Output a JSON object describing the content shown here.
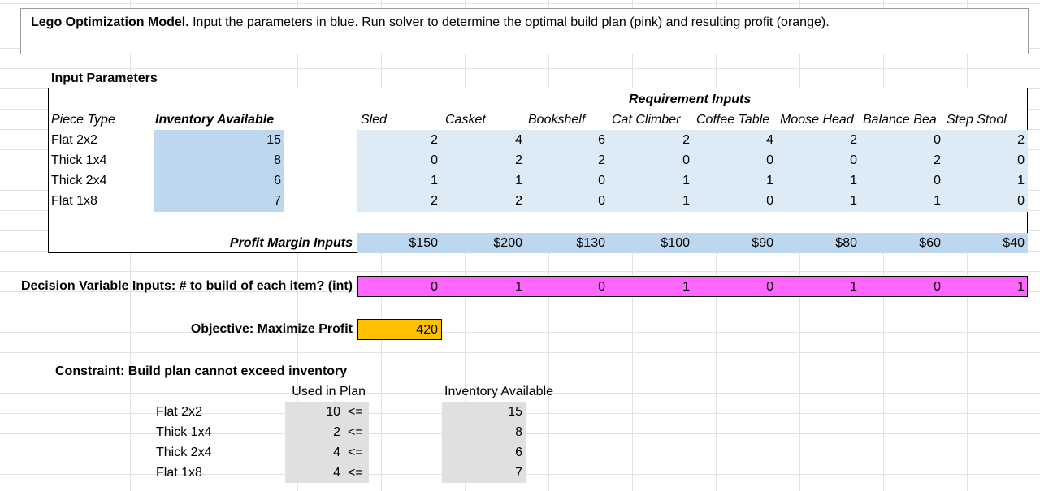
{
  "title": {
    "bold": "Lego Optimization Model.",
    "rest": " Input the parameters in blue. Run solver to determine the optimal build plan (pink) and resulting profit (orange)."
  },
  "input_params_label": "Input Parameters",
  "requirement_inputs_label": "Requirement Inputs",
  "headers": {
    "piece_type": "Piece Type",
    "inventory": "Inventory Available",
    "items": [
      "Sled",
      "Casket",
      "Bookshelf",
      "Cat Climber",
      "Coffee Table",
      "Moose Head",
      "Balance Beam",
      "Step Stool"
    ],
    "item_display": [
      "Sled",
      "Casket",
      "Bookshelf",
      "Cat Climber",
      "Coffee Table",
      "Moose Head",
      "Balance Bea",
      "Step Stool"
    ]
  },
  "pieces": [
    {
      "name": "Flat 2x2",
      "inventory": "15",
      "req": [
        "2",
        "4",
        "6",
        "2",
        "4",
        "2",
        "0",
        "2"
      ]
    },
    {
      "name": "Thick 1x4",
      "inventory": "8",
      "req": [
        "0",
        "2",
        "2",
        "0",
        "0",
        "0",
        "2",
        "0"
      ]
    },
    {
      "name": "Thick 2x4",
      "inventory": "6",
      "req": [
        "1",
        "1",
        "0",
        "1",
        "1",
        "1",
        "0",
        "1"
      ]
    },
    {
      "name": "Flat 1x8",
      "inventory": "7",
      "req": [
        "2",
        "2",
        "0",
        "1",
        "0",
        "1",
        "1",
        "0"
      ]
    }
  ],
  "profit_margin_label": "Profit Margin Inputs",
  "profit_margins": [
    "$150",
    "$200",
    "$130",
    "$100",
    "$90",
    "$80",
    "$60",
    "$40"
  ],
  "decision_label": "Decision Variable Inputs: # to build of each item? (int)",
  "decision_values": [
    "0",
    "1",
    "0",
    "1",
    "0",
    "1",
    "0",
    "1"
  ],
  "objective_label": "Objective: Maximize Profit",
  "objective_value": "420",
  "constraint": {
    "title": "Constraint: Build plan cannot exceed inventory",
    "used_header": "Used in Plan",
    "avail_header": "Inventory Available",
    "rows": [
      {
        "name": "Flat 2x2",
        "used": "10",
        "op": "<=",
        "available": "15"
      },
      {
        "name": "Thick 1x4",
        "used": "2",
        "op": "<=",
        "available": "8"
      },
      {
        "name": "Thick 2x4",
        "used": "4",
        "op": "<=",
        "available": "6"
      },
      {
        "name": "Flat 1x8",
        "used": "4",
        "op": "<=",
        "available": "7"
      }
    ]
  },
  "colors": {
    "input_blue": "#bdd7ee",
    "requirement_blue": "#ddebf7",
    "decision_pink": "#ff66ff",
    "objective_orange": "#ffc000",
    "constraint_grey": "#e0e0e0"
  }
}
